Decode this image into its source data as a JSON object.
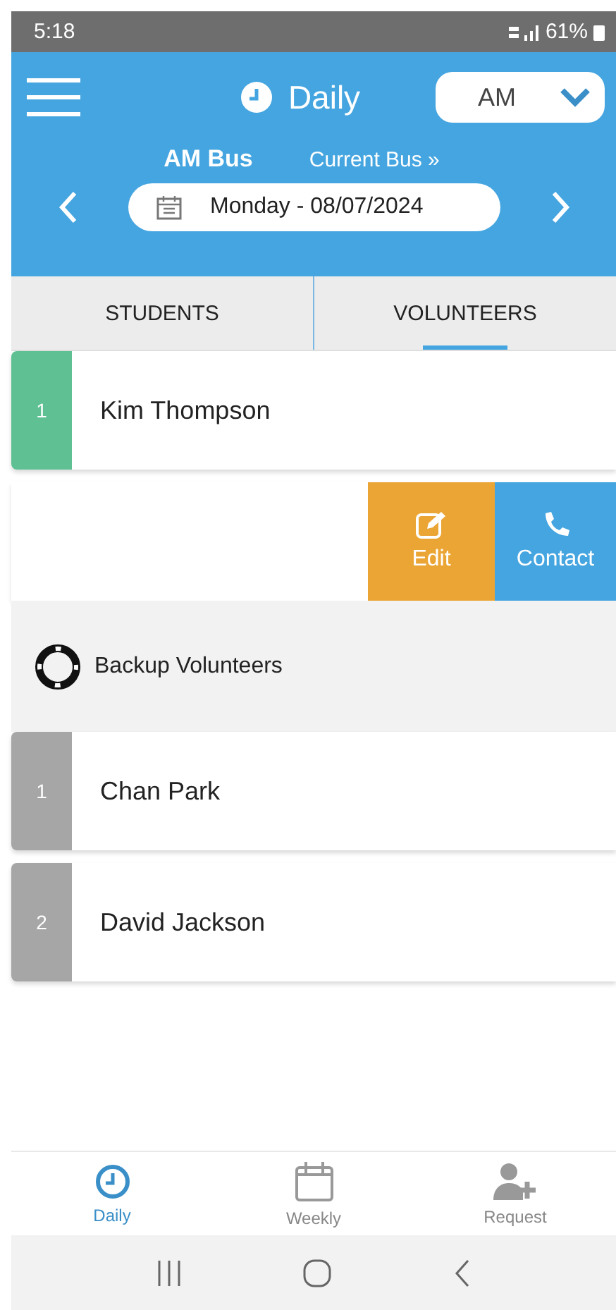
{
  "status_bar": {
    "time": "5:18",
    "battery": "61%"
  },
  "header": {
    "title": "Daily",
    "period_select": {
      "value": "AM"
    },
    "bus_label": "AM Bus",
    "current_bus_link": "Current Bus »",
    "date": "Monday - 08/07/2024"
  },
  "tabs": [
    {
      "label": "STUDENTS",
      "selected": false
    },
    {
      "label": "VOLUNTEERS",
      "selected": true
    }
  ],
  "volunteers": [
    {
      "number": "1",
      "name": "Kim Thompson",
      "color": "#5fc193"
    }
  ],
  "swipe_actions": [
    {
      "label": "Edit",
      "kind": "edit"
    },
    {
      "label": "Contact",
      "kind": "contact"
    }
  ],
  "backup": {
    "title": "Backup Volunteers",
    "volunteers": [
      {
        "number": "1",
        "name": "Chan Park",
        "color": "#a6a6a6"
      },
      {
        "number": "2",
        "name": "David Jackson",
        "color": "#a6a6a6"
      }
    ]
  },
  "bottom_nav": [
    {
      "label": "Daily",
      "kind": "daily",
      "selected": true
    },
    {
      "label": "Weekly",
      "kind": "weekly",
      "selected": false
    },
    {
      "label": "Request",
      "kind": "request",
      "selected": false
    }
  ]
}
